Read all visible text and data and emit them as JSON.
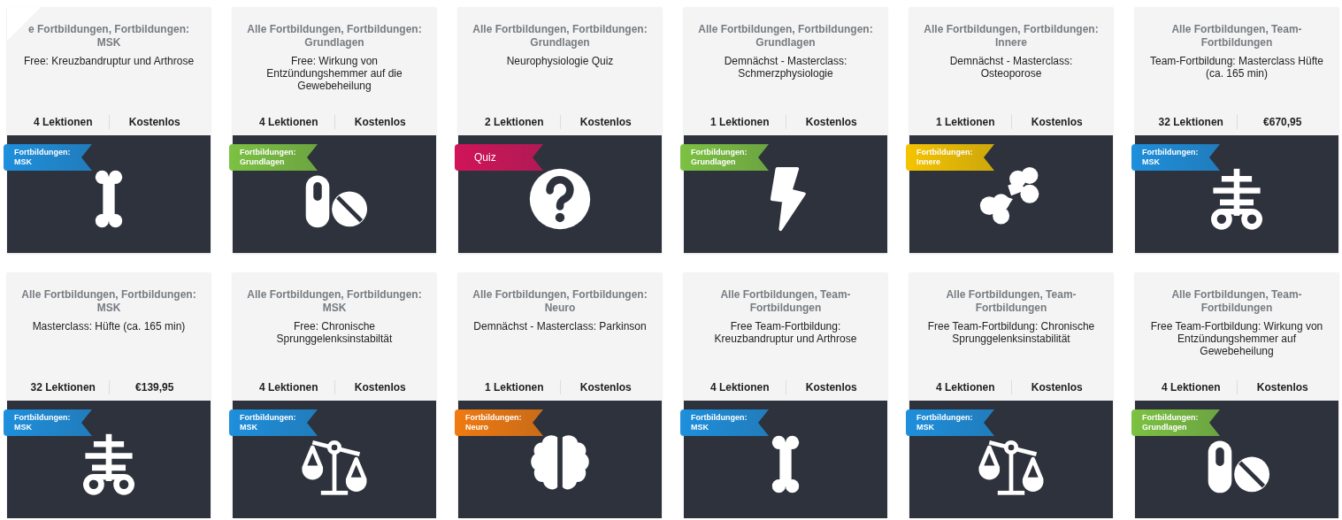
{
  "cards": [
    {
      "category": "e Fortbildungen, Fortbildungen: MSK",
      "title": "Free: Kreuzbandruptur und Arthrose",
      "lessons": "4 Lektionen",
      "price": "Kostenlos",
      "folded_corner": true,
      "ribbon": {
        "kind": "category",
        "label": "Fortbildungen: MSK",
        "color": "#1e8fdc"
      },
      "kind": "bone"
    },
    {
      "category": "Alle Fortbildungen, Fortbildungen: Grundlagen",
      "title": "Free: Wirkung von Entzündungshemmer auf die Gewebeheilung",
      "lessons": "4 Lektionen",
      "price": "Kostenlos",
      "ribbon": {
        "kind": "category",
        "label": "Fortbildungen: Grundlagen",
        "color": "#7cc142"
      },
      "kind": "pills"
    },
    {
      "category": "Alle Fortbildungen, Fortbildungen: Grundlagen",
      "title": "Neurophysiologie Quiz",
      "lessons": "2 Lektionen",
      "price": "Kostenlos",
      "ribbon": {
        "kind": "quiz",
        "label": "Quiz",
        "color": "#d1145a"
      },
      "kind": "question"
    },
    {
      "category": "Alle Fortbildungen, Fortbildungen: Grundlagen",
      "title": "Demnächst - Masterclass: Schmerzphysiologie",
      "lessons": "1 Lektionen",
      "price": "Kostenlos",
      "ribbon": {
        "kind": "category",
        "label": "Fortbildungen: Grundlagen",
        "color": "#7cc142"
      },
      "kind": "bolt"
    },
    {
      "category": "Alle Fortbildungen, Fortbildungen: Innere",
      "title": "Demnächst - Masterclass: Osteoporose",
      "lessons": "1 Lektionen",
      "price": "Kostenlos",
      "ribbon": {
        "kind": "category",
        "label": "Fortbildungen: Innere",
        "color": "#f5c400"
      },
      "kind": "cells"
    },
    {
      "category": "Alle Fortbildungen, Team-Fortbildungen",
      "title": "Team-Fortbildung: Masterclass Hüfte (ca. 165 min)",
      "lessons": "32 Lektionen",
      "price": "€670,95",
      "ribbon": {
        "kind": "category",
        "label": "Fortbildungen: MSK",
        "color": "#1e8fdc"
      },
      "kind": "hip"
    },
    {
      "category": "Alle Fortbildungen, Fortbildungen: MSK",
      "title": "Masterclass: Hüfte (ca. 165 min)",
      "lessons": "32 Lektionen",
      "price": "€139,95",
      "ribbon": {
        "kind": "category",
        "label": "Fortbildungen: MSK",
        "color": "#1e8fdc"
      },
      "kind": "hip"
    },
    {
      "category": "Alle Fortbildungen, Fortbildungen: MSK",
      "title": "Free: Chronische Sprunggelenksinstabiltät",
      "lessons": "4 Lektionen",
      "price": "Kostenlos",
      "ribbon": {
        "kind": "category",
        "label": "Fortbildungen: MSK",
        "color": "#1e8fdc"
      },
      "kind": "scales"
    },
    {
      "category": "Alle Fortbildungen, Fortbildungen: Neuro",
      "title": "Demnächst - Masterclass: Parkinson",
      "lessons": "1 Lektionen",
      "price": "Kostenlos",
      "ribbon": {
        "kind": "category",
        "label": "Fortbildungen: Neuro",
        "color": "#f07a10"
      },
      "kind": "brain"
    },
    {
      "category": "Alle Fortbildungen, Team-Fortbildungen",
      "title": "Free Team-Fortbildung: Kreuzbandruptur und Arthrose",
      "lessons": "4 Lektionen",
      "price": "Kostenlos",
      "ribbon": {
        "kind": "category",
        "label": "Fortbildungen: MSK",
        "color": "#1e8fdc"
      },
      "kind": "bone"
    },
    {
      "category": "Alle Fortbildungen, Team-Fortbildungen",
      "title": "Free Team-Fortbildung: Chronische Sprunggelenksinstabilität",
      "lessons": "4 Lektionen",
      "price": "Kostenlos",
      "ribbon": {
        "kind": "category",
        "label": "Fortbildungen: MSK",
        "color": "#1e8fdc"
      },
      "kind": "scales"
    },
    {
      "category": "Alle Fortbildungen, Team-Fortbildungen",
      "title": "Free Team-Fortbildung: Wirkung von Entzündungshemmer auf Gewebeheilung",
      "lessons": "4 Lektionen",
      "price": "Kostenlos",
      "ribbon": {
        "kind": "category",
        "label": "Fortbildungen: Grundlagen",
        "color": "#7cc142"
      },
      "kind": "pills"
    }
  ]
}
